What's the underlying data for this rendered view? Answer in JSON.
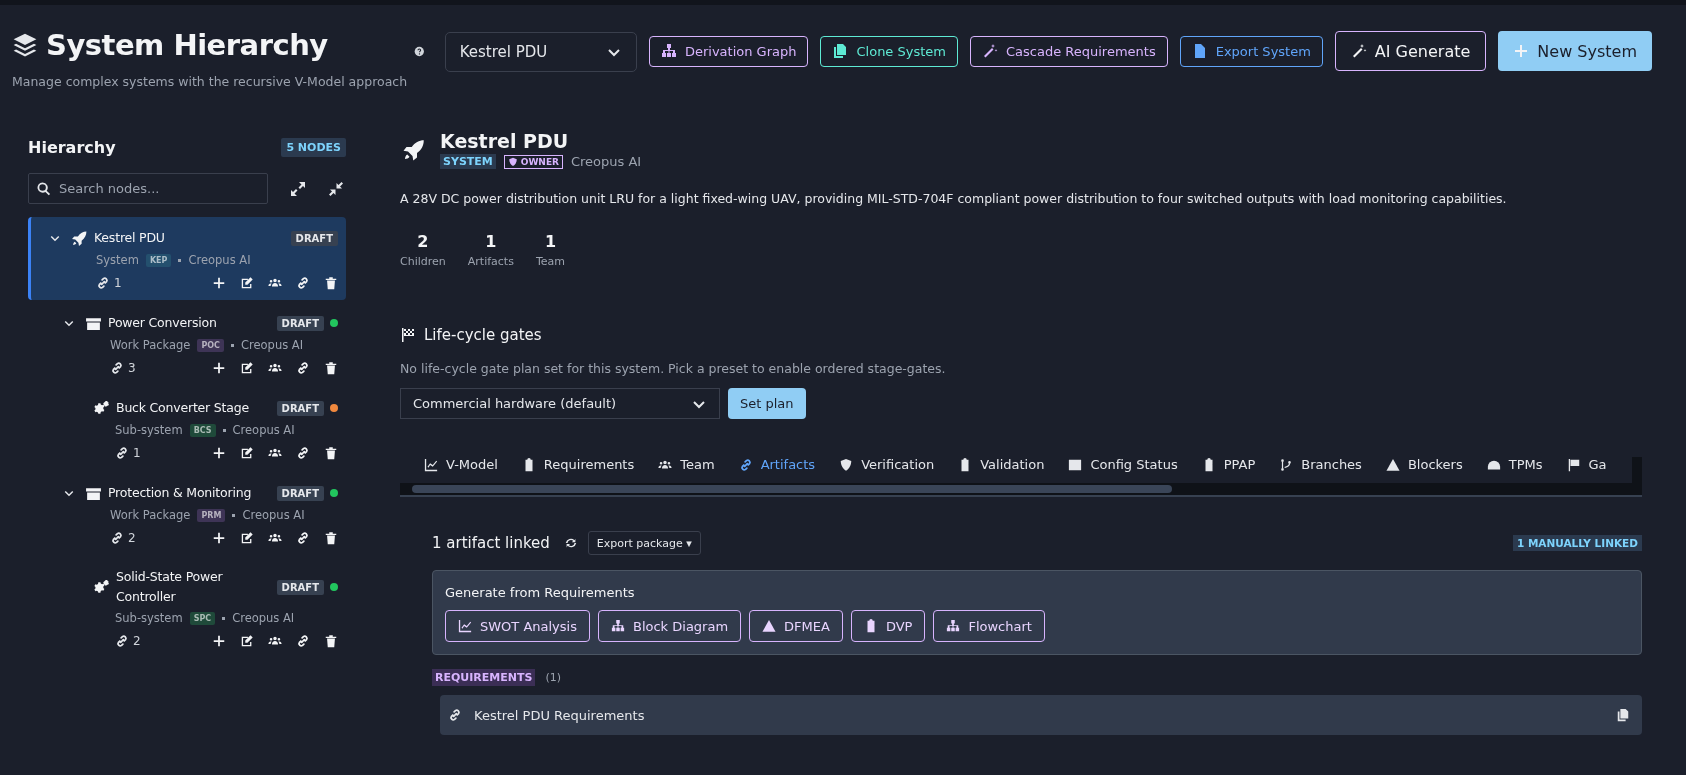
{
  "header": {
    "title": "System Hierarchy",
    "subtitle": "Manage complex systems with the recursive V-Model approach",
    "system_select": {
      "value": "Kestrel PDU"
    },
    "buttons": [
      {
        "label": "Derivation Graph",
        "kind": "outline",
        "color": "#d8b4fe"
      },
      {
        "label": "Clone System",
        "kind": "outline",
        "color": "#5eead4"
      },
      {
        "label": "Cascade Requirements",
        "kind": "outline",
        "color": "#d8b4fe"
      },
      {
        "label": "Export System",
        "kind": "outline",
        "color": "#60a5fa"
      },
      {
        "label": "AI Generate",
        "kind": "large",
        "color": "#d8b4fe"
      },
      {
        "label": "New System",
        "kind": "filled",
        "color": "#90cdf4"
      }
    ]
  },
  "sidebar": {
    "title": "Hierarchy",
    "count_badge": "5 NODES",
    "search": {
      "placeholder": "Search nodes..."
    },
    "tree": [
      {
        "name": "Kestrel PDU",
        "type": "System",
        "code": {
          "label": "KEP",
          "color": "#24506e"
        },
        "owner": "Creopus AI",
        "links": "1",
        "status": "DRAFT",
        "selected": true,
        "expanded": true,
        "children": [
          {
            "name": "Power Conversion",
            "type": "Work Package",
            "code": {
              "label": "POC",
              "color": "#3e3456"
            },
            "owner": "Creopus AI",
            "links": "3",
            "status": "DRAFT",
            "color": "#22c55e",
            "selected": false,
            "expanded": true,
            "children": [
              {
                "name": "Buck Converter Stage",
                "type": "Sub-system",
                "code": {
                  "label": "BCS",
                  "color": "#1f4a3a"
                },
                "owner": "Creopus AI",
                "links": "1",
                "status": "DRAFT",
                "color": "#f0883e",
                "selected": false
              }
            ]
          },
          {
            "name": "Protection & Monitoring",
            "type": "Work Package",
            "code": {
              "label": "PRM",
              "color": "#3e3456"
            },
            "owner": "Creopus AI",
            "links": "2",
            "status": "DRAFT",
            "color": "#22c55e",
            "selected": false,
            "expanded": true,
            "children": [
              {
                "name": "Solid-State Power Controller",
                "type": "Sub-system",
                "code": {
                  "label": "SPC",
                  "color": "#1f4a3a"
                },
                "owner": "Creopus AI",
                "links": "2",
                "status": "DRAFT",
                "color": "#22c55e",
                "selected": false
              }
            ]
          }
        ]
      }
    ]
  },
  "detail": {
    "title": "Kestrel PDU",
    "type_badge": "SYSTEM",
    "role_badge": "OWNER",
    "owner": "Creopus AI",
    "description": "A 28V DC power distribution unit LRU for a light fixed-wing UAV, providing MIL-STD-704F compliant power distribution to four switched outputs with load monitoring capabilities.",
    "stats": [
      {
        "value": "2",
        "label": "Children"
      },
      {
        "value": "1",
        "label": "Artifacts"
      },
      {
        "value": "1",
        "label": "Team"
      }
    ],
    "lifecycle": {
      "title": "Life-cycle gates",
      "message": "No life-cycle gate plan set for this system. Pick a preset to enable ordered stage-gates.",
      "preset": "Commercial hardware (default)",
      "button": "Set plan"
    },
    "tabs": [
      {
        "label": "V-Model",
        "selected": false
      },
      {
        "label": "Requirements",
        "selected": false
      },
      {
        "label": "Team",
        "selected": false
      },
      {
        "label": "Artifacts",
        "selected": true
      },
      {
        "label": "Verification",
        "selected": false
      },
      {
        "label": "Validation",
        "selected": false
      },
      {
        "label": "Config Status",
        "selected": false
      },
      {
        "label": "PPAP",
        "selected": false
      },
      {
        "label": "Branches",
        "selected": false
      },
      {
        "label": "Blockers",
        "selected": false
      },
      {
        "label": "TPMs",
        "selected": false
      },
      {
        "label": "Ga",
        "selected": false
      }
    ],
    "artifacts": {
      "summary": "1 artifact linked",
      "export": "Export package ▾",
      "linked_badge": "1 MANUALLY LINKED",
      "generate": {
        "title": "Generate from Requirements",
        "buttons": [
          "SWOT Analysis",
          "Block Diagram",
          "DFMEA",
          "DVP",
          "Flowchart"
        ]
      },
      "groups": [
        {
          "label": "REQUIREMENTS",
          "count": "(1)",
          "items": [
            "Kestrel PDU Requirements"
          ]
        }
      ]
    }
  }
}
